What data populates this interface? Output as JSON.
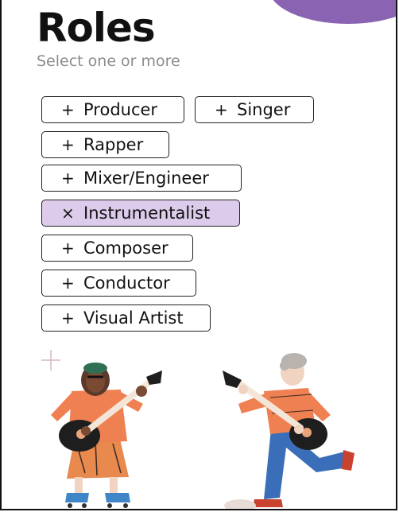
{
  "header": {
    "title": "Roles",
    "subtitle": "Select one or more"
  },
  "roles": [
    {
      "label": "Producer",
      "sign": "+",
      "selected": false
    },
    {
      "label": "Singer",
      "sign": "+",
      "selected": false
    },
    {
      "label": "Rapper",
      "sign": "+",
      "selected": false
    },
    {
      "label": "Mixer/Engineer",
      "sign": "+",
      "selected": false
    },
    {
      "label": "Instrumentalist",
      "sign": "×",
      "selected": true
    },
    {
      "label": "Composer",
      "sign": "+",
      "selected": false
    },
    {
      "label": "Conductor",
      "sign": "+",
      "selected": false
    },
    {
      "label": "Visual Artist",
      "sign": "+",
      "selected": false
    }
  ],
  "colors": {
    "accent": "#8a63b3",
    "selected_chip": "#dccbea",
    "subtitle": "#8c8c8c"
  },
  "illustration": {
    "subject": "two-guitarists-illustration"
  }
}
